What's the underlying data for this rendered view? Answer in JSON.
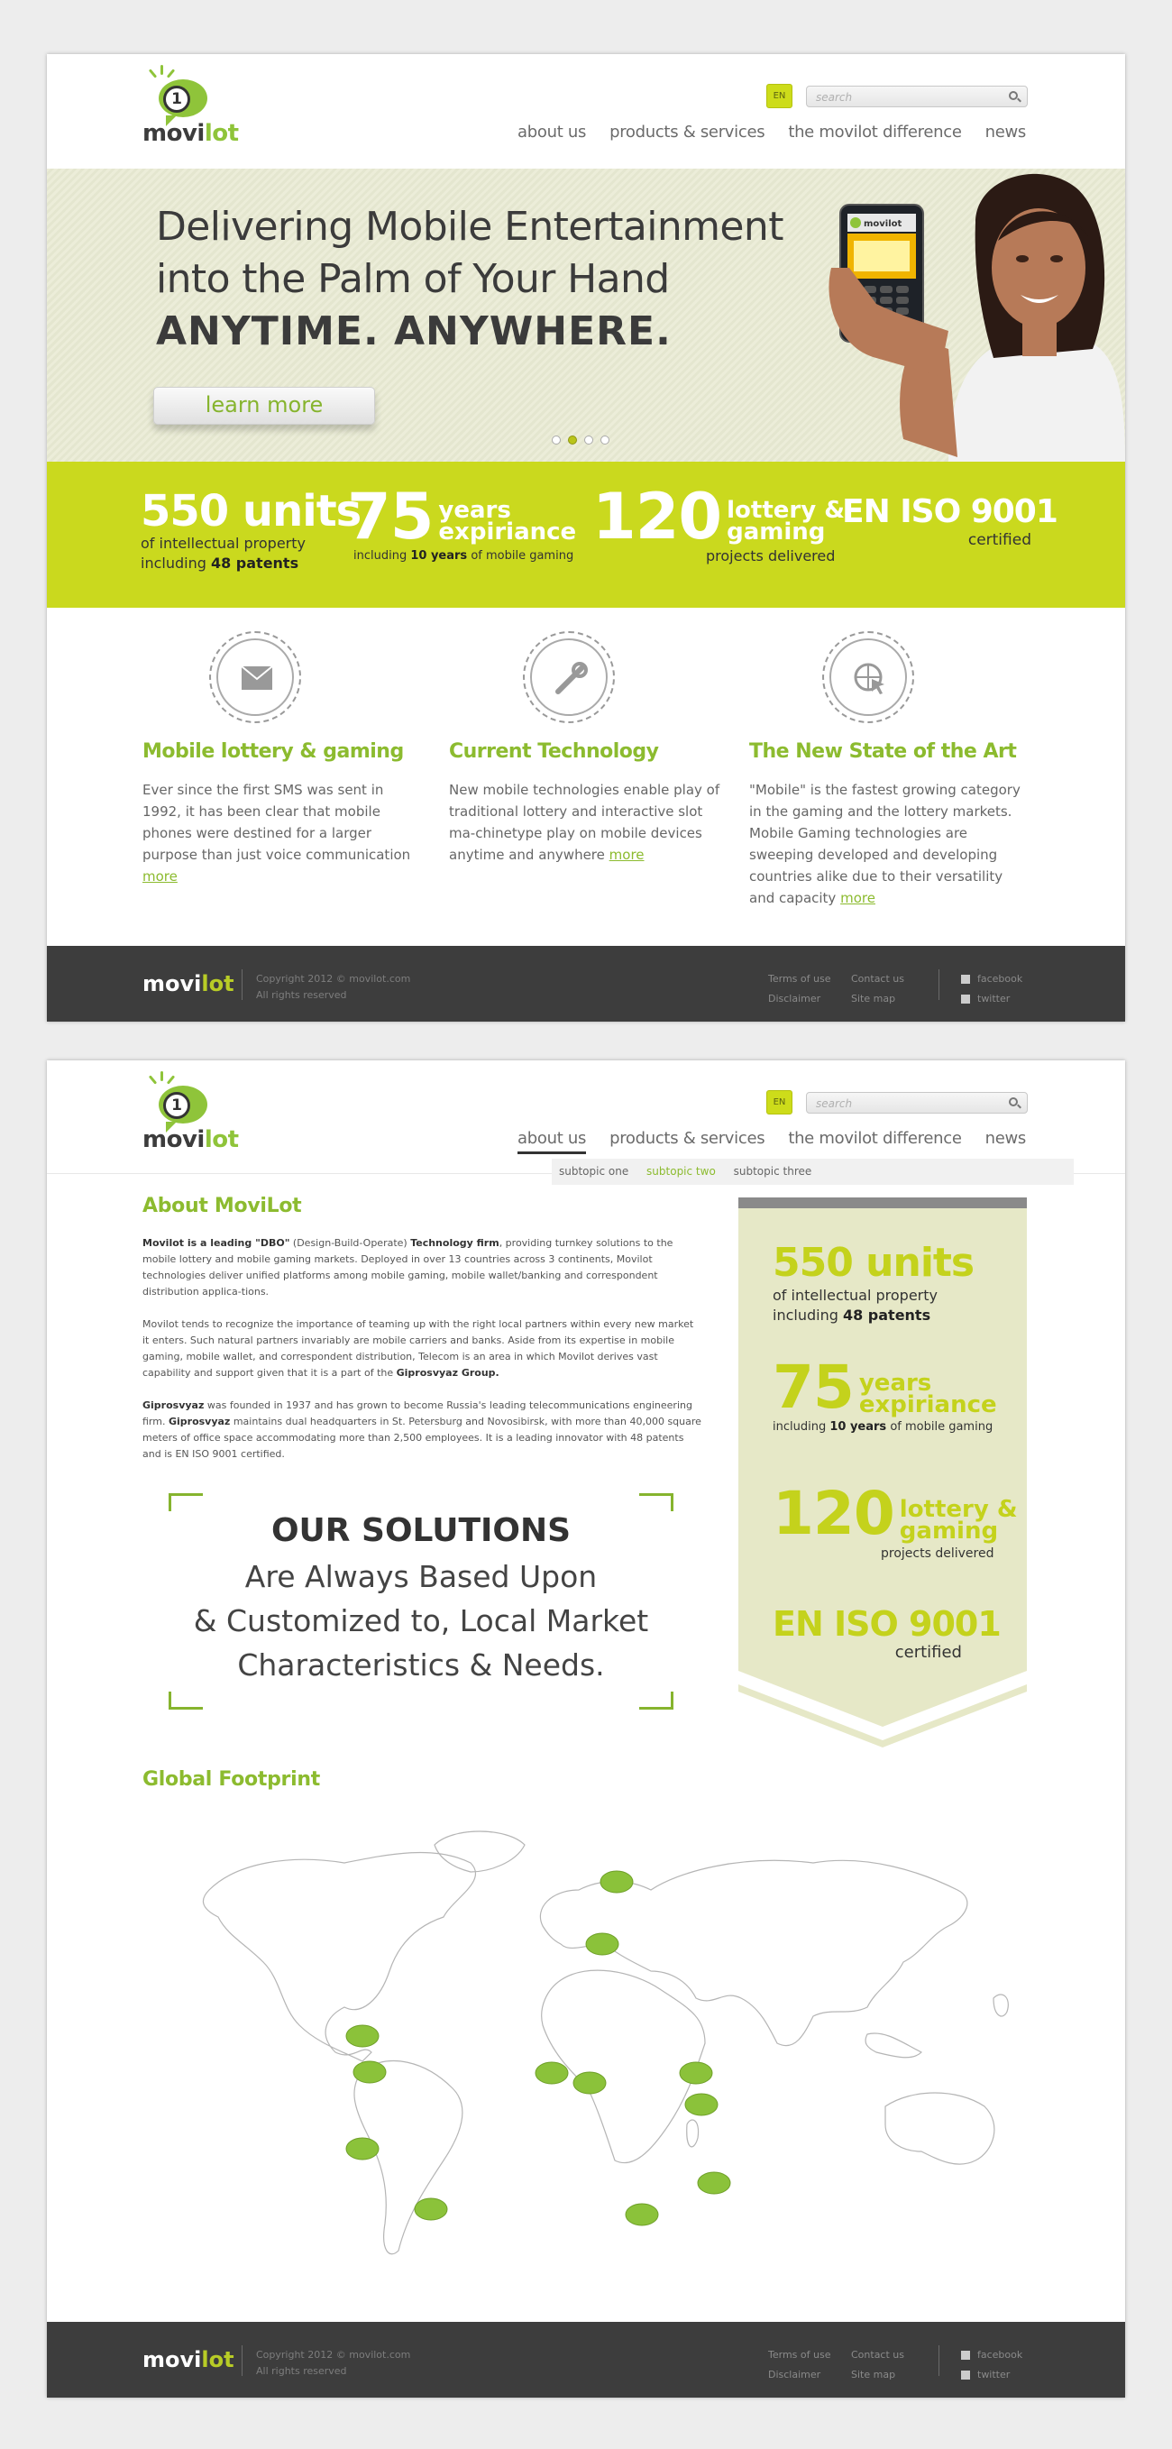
{
  "lang": "EN",
  "search": {
    "placeholder": "search"
  },
  "logo": {
    "digit": "1",
    "word_a": "movi",
    "word_b": "lot"
  },
  "nav": [
    "about us",
    "products & services",
    "the movilot difference",
    "news"
  ],
  "hero": {
    "line1": "Delivering Mobile Entertainment",
    "line2": "into the Palm of Your Hand",
    "line3": "ANYTIME. ANYWHERE.",
    "cta": "learn more",
    "phone_brand": "movilot"
  },
  "stats": {
    "s1": {
      "big": "550 units",
      "l1": "of intellectual property",
      "l2a": "including ",
      "l2b": "48 patents"
    },
    "s2": {
      "big": "75",
      "mid1": "years",
      "mid2": "expiriance",
      "la": "including ",
      "lb": "10 years",
      "lc": " of mobile gaming"
    },
    "s3": {
      "big": "120",
      "mid1": "lottery &",
      "mid2": "gaming",
      "l": "projects delivered"
    },
    "s4": {
      "big": "EN ISO 9001",
      "l": "certified"
    }
  },
  "features": [
    {
      "icon": "envelope-icon",
      "title": "Mobile lottery & gaming",
      "text": "Ever since the first SMS was sent in 1992, it has been clear that mobile phones were destined for a larger purpose than just voice communication",
      "more": "more"
    },
    {
      "icon": "tools-icon",
      "title": "Current Technology",
      "text": "New mobile technologies enable play of traditional lottery and interactive slot ma-chinetype play on mobile devices anytime and anywhere",
      "more": "more"
    },
    {
      "icon": "globe-cursor-icon",
      "title": "The New State of the Art",
      "text": "\"Mobile\" is the fastest growing category in the gaming and the lottery markets. Mobile Gaming technologies are sweeping developed and developing countries alike due to their versatility and capacity",
      "more": "more"
    }
  ],
  "footer": {
    "copy1": "Copyright 2012 © movilot.com",
    "copy2": "All rights reserved",
    "links": [
      "Terms of use",
      "Contact us",
      "Disclaimer",
      "Site map"
    ],
    "social": [
      "facebook",
      "twitter"
    ]
  },
  "subnav": [
    "subtopic one",
    "subtopic two",
    "subtopic three"
  ],
  "about": {
    "title": "About MoviLot",
    "p1a": "Movilot is a leading \"DBO\"",
    "p1b": " (Design-Build-Operate) ",
    "p1c": "Technology firm",
    "p1d": ", providing turnkey solutions to the mobile lottery and mobile gaming markets. Deployed in over 13 countries across 3 continents, Movilot technologies deliver unified platforms among mobile gaming, mobile wallet/banking and correspondent distribution applica-tions.",
    "p2a": "Movilot tends to recognize the importance of teaming up with the right local partners within every new market it enters. Such natural partners invariably are mobile carriers and banks. Aside from its expertise in mobile gaming, mobile wallet, and correspondent distribution, Telecom is an area in which Movilot derives vast capability and support given that it is a part of the ",
    "p2b": "Giprosvyaz Group.",
    "p3a": "Giprosvyaz",
    "p3b": " was founded in 1937 and has grown to become Russia's leading telecommunications engineering firm. ",
    "p3c": "Giprosvyaz",
    "p3d": " maintains dual headquarters in St. Petersburg and Novosibirsk, with more than 40,000 square meters of office space accommodating more than 2,500 employees. It is a leading innovator with 48 patents and is EN ISO 9001 certified."
  },
  "solutions": {
    "title": "OUR SOLUTIONS",
    "l1": "Are Always Based Upon",
    "l2": "& Customized to, Local Market",
    "l3": "Characteristics & Needs."
  },
  "footprint": {
    "title": "Global Footprint"
  },
  "colors": {
    "green": "#8cbb2f",
    "lime": "#cad91e",
    "dark": "#3d3d3d"
  }
}
